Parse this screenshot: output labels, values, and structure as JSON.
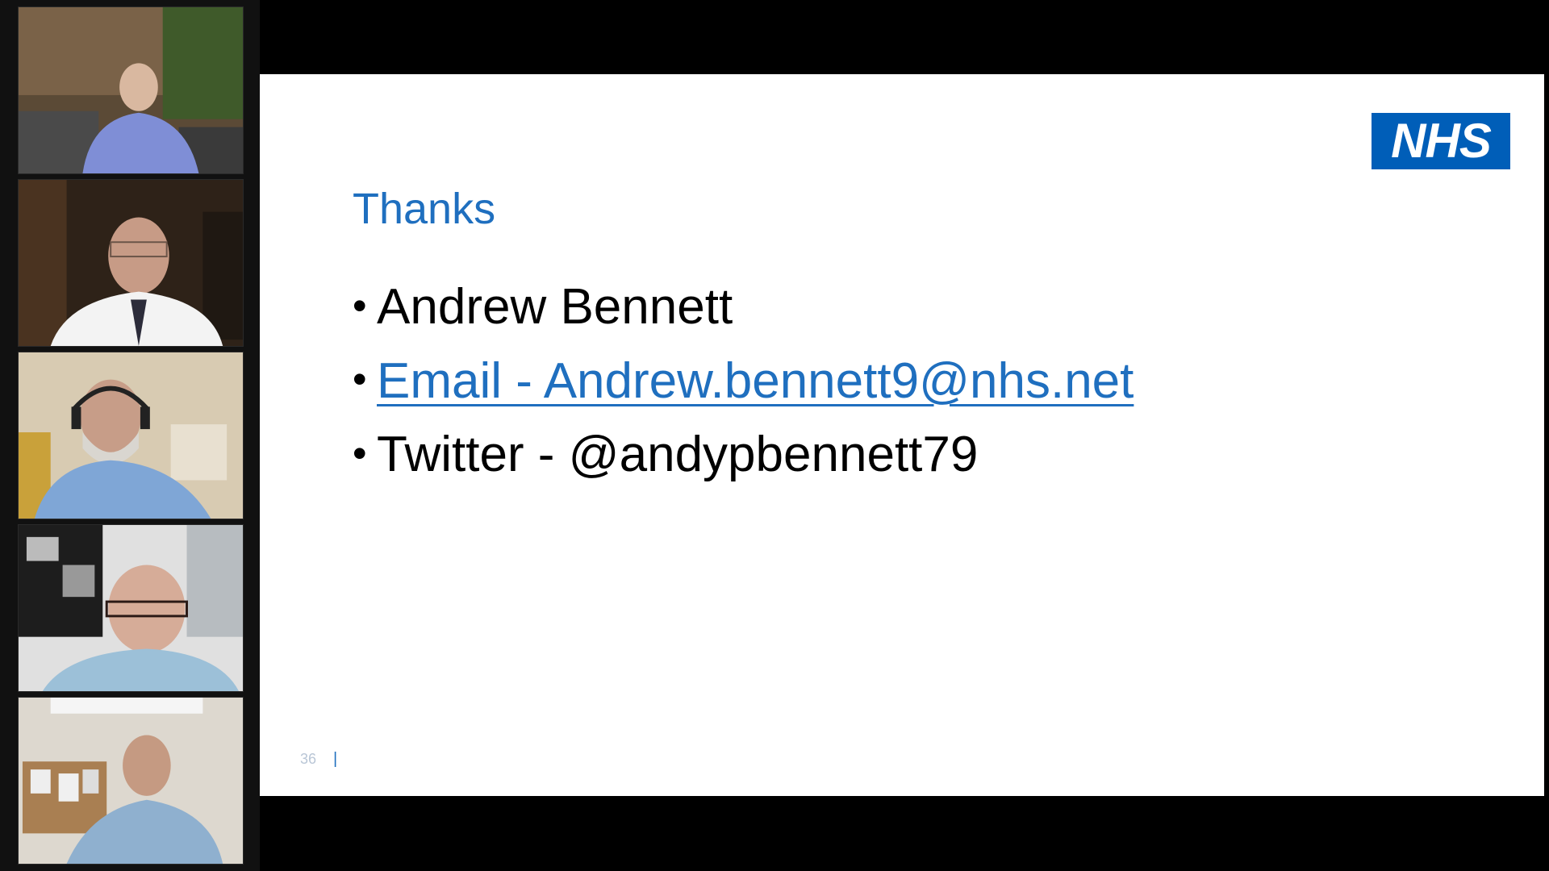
{
  "participants": [
    {
      "id": "p1",
      "label": ""
    },
    {
      "id": "p2",
      "label": ""
    },
    {
      "id": "p3",
      "label": ""
    },
    {
      "id": "p4",
      "label": ""
    },
    {
      "id": "p5",
      "label": ""
    }
  ],
  "slide": {
    "logo_text": "NHS",
    "title": "Thanks",
    "bullets": [
      {
        "text": "Andrew Bennett",
        "link": false
      },
      {
        "text": "Email - Andrew.bennett9@nhs.net",
        "link": true
      },
      {
        "text": "Twitter - @andypbennett79",
        "link": false
      }
    ],
    "page_number": "36",
    "footer_separator": "|"
  },
  "colors": {
    "nhs_blue": "#005eb8",
    "title_blue": "#1f6fbf",
    "background": "#000000"
  }
}
